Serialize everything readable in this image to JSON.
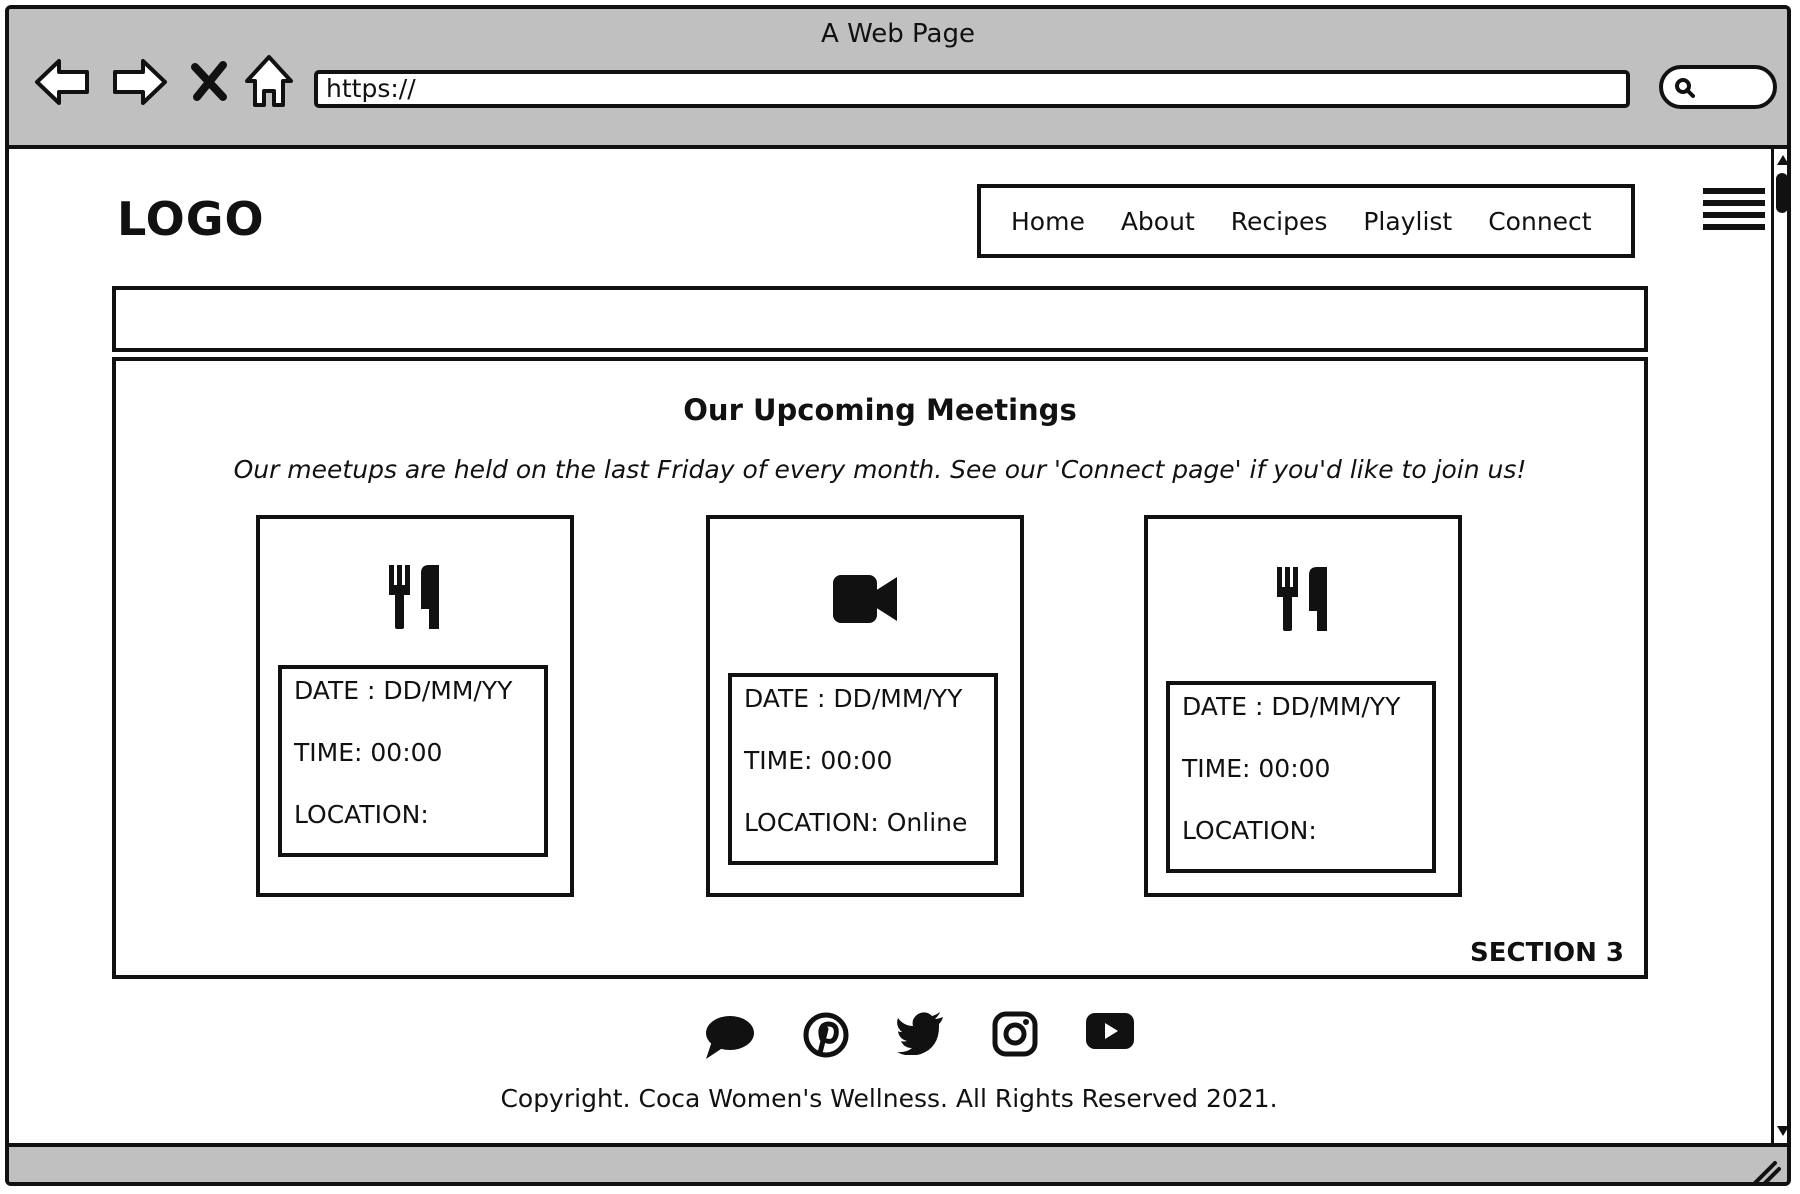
{
  "window": {
    "title": "A Web Page",
    "url": "https://"
  },
  "site": {
    "logo": "LOGO",
    "nav": [
      "Home",
      "About",
      "Recipes",
      "Playlist",
      "Connect"
    ]
  },
  "section": {
    "title": "Our Upcoming Meetings",
    "subtitle": "Our meetups are held on the last Friday of every month. See our 'Connect page' if you'd like to join us!",
    "label": "SECTION 3"
  },
  "meetings": [
    {
      "icon": "fork-knife-icon",
      "date": "DATE :  DD/MM/YY",
      "time": "TIME: 00:00",
      "location": "LOCATION:"
    },
    {
      "icon": "video-camera-icon",
      "date": "DATE :  DD/MM/YY",
      "time": "TIME: 00:00",
      "location": "LOCATION:  Online"
    },
    {
      "icon": "fork-knife-icon",
      "date": "DATE :  DD/MM/YY",
      "time": "TIME: 00:00",
      "location": "LOCATION:"
    }
  ],
  "footer": {
    "social_icons": [
      "chat-icon",
      "pinterest-icon",
      "twitter-icon",
      "instagram-icon",
      "youtube-icon"
    ],
    "copyright": "Copyright. Coca Women's Wellness. All Rights Reserved 2021."
  }
}
